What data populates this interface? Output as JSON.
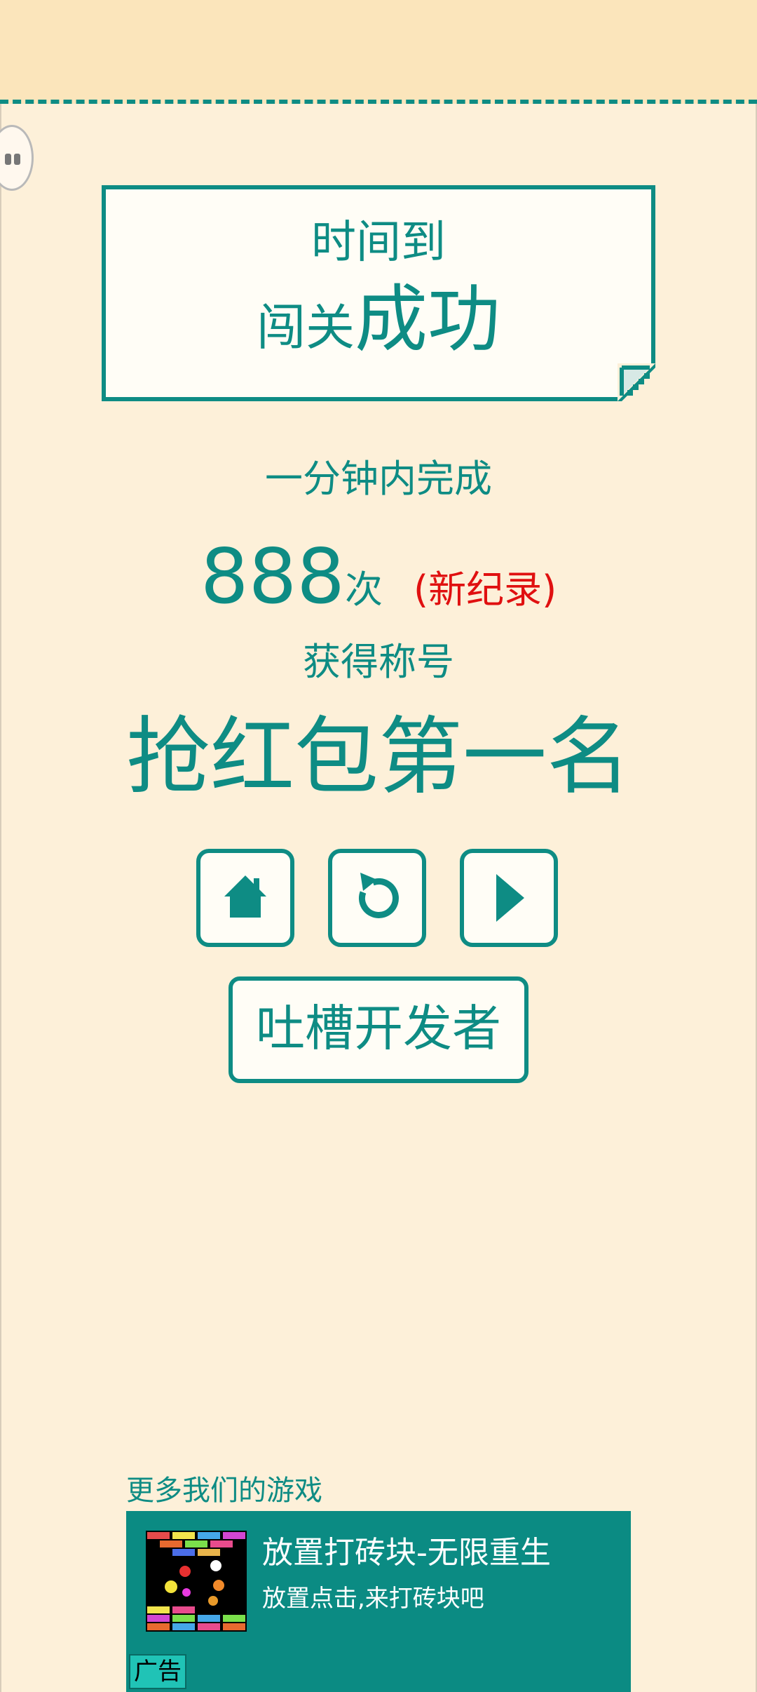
{
  "result": {
    "line1": "时间到",
    "line2_prefix": "闯关",
    "line2_main": "成功"
  },
  "subtitle": "一分钟内完成",
  "score": {
    "value": "888",
    "unit": "次",
    "record": "(新纪录)"
  },
  "honor": {
    "label": "获得称号",
    "title": "抢红包第一名"
  },
  "buttons": {
    "home": "home-icon",
    "restart": "restart-icon",
    "next": "play-icon",
    "feedback_label": "吐槽开发者"
  },
  "more_games": {
    "label": "更多我们的游戏",
    "ad": {
      "title": "放置打砖块-无限重生",
      "description": "放置点击,来打砖块吧",
      "tag": "广告"
    }
  },
  "colors": {
    "accent": "#0e8c84",
    "background": "#fdf0d9",
    "header": "#fbe5bb",
    "record": "#e01010",
    "ad_background": "#0b8b83"
  }
}
